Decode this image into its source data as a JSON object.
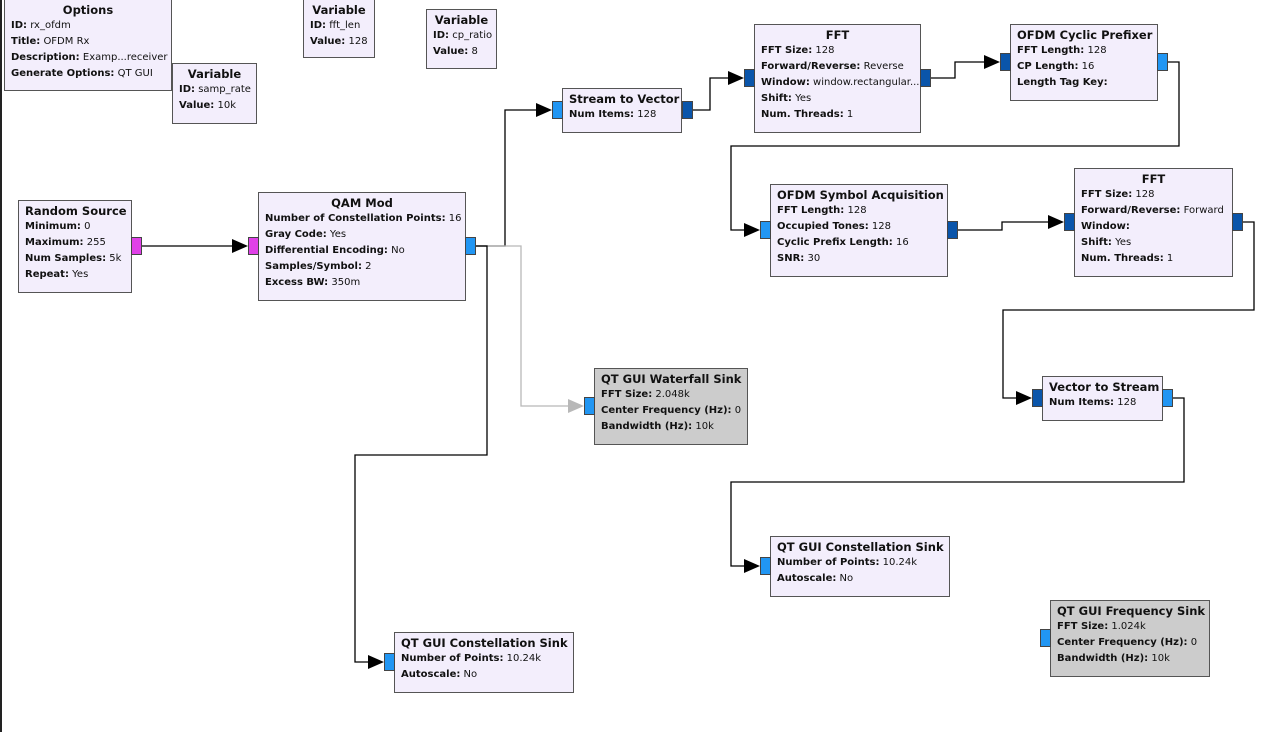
{
  "canvas": {
    "background": "#ffffff"
  },
  "colors": {
    "block_fill": "#f3eefc",
    "block_disabled_fill": "#cccccc",
    "port_byte": "#e040e8",
    "port_complex": "#2196f3",
    "port_complex_vector": "#0a55aa",
    "wire": "#000000",
    "wire_disabled": "#b8b8b8"
  },
  "blocks": {
    "options": {
      "title": "Options",
      "params": [
        {
          "key": "ID:",
          "value": "rx_ofdm"
        },
        {
          "key": "Title:",
          "value": "OFDM Rx"
        },
        {
          "key": "Description:",
          "value": "Examp...receiver"
        },
        {
          "key": "Generate Options:",
          "value": "QT GUI"
        }
      ]
    },
    "var_samp_rate": {
      "title": "Variable",
      "params": [
        {
          "key": "ID:",
          "value": "samp_rate"
        },
        {
          "key": "Value:",
          "value": "10k"
        }
      ]
    },
    "var_fft_len": {
      "title": "Variable",
      "params": [
        {
          "key": "ID:",
          "value": "fft_len"
        },
        {
          "key": "Value:",
          "value": "128"
        }
      ]
    },
    "var_cp_ratio": {
      "title": "Variable",
      "params": [
        {
          "key": "ID:",
          "value": "cp_ratio"
        },
        {
          "key": "Value:",
          "value": "8"
        }
      ]
    },
    "random_source": {
      "title": "Random Source",
      "params": [
        {
          "key": "Minimum:",
          "value": "0"
        },
        {
          "key": "Maximum:",
          "value": "255"
        },
        {
          "key": "Num Samples:",
          "value": "5k"
        },
        {
          "key": "Repeat:",
          "value": "Yes"
        }
      ]
    },
    "qam_mod": {
      "title": "QAM Mod",
      "params": [
        {
          "key": "Number of Constellation Points:",
          "value": "16"
        },
        {
          "key": "Gray Code:",
          "value": "Yes"
        },
        {
          "key": "Differential Encoding:",
          "value": "No"
        },
        {
          "key": "Samples/Symbol:",
          "value": "2"
        },
        {
          "key": "Excess BW:",
          "value": "350m"
        }
      ]
    },
    "stream_to_vector": {
      "title": "Stream to Vector",
      "params": [
        {
          "key": "Num Items:",
          "value": "128"
        }
      ]
    },
    "fft_reverse": {
      "title": "FFT",
      "params": [
        {
          "key": "FFT Size:",
          "value": "128"
        },
        {
          "key": "Forward/Reverse:",
          "value": "Reverse"
        },
        {
          "key": "Window:",
          "value": "window.rectangular..."
        },
        {
          "key": "Shift:",
          "value": "Yes"
        },
        {
          "key": "Num. Threads:",
          "value": "1"
        }
      ]
    },
    "cyclic_prefixer": {
      "title": "OFDM Cyclic Prefixer",
      "params": [
        {
          "key": "FFT Length:",
          "value": "128"
        },
        {
          "key": "CP Length:",
          "value": "16"
        },
        {
          "key": "Length Tag Key:",
          "value": ""
        }
      ]
    },
    "symbol_acquisition": {
      "title": "OFDM Symbol Acquisition",
      "params": [
        {
          "key": "FFT Length:",
          "value": "128"
        },
        {
          "key": "Occupied Tones:",
          "value": "128"
        },
        {
          "key": "Cyclic Prefix Length:",
          "value": "16"
        },
        {
          "key": "SNR:",
          "value": "30"
        }
      ]
    },
    "fft_forward": {
      "title": "FFT",
      "params": [
        {
          "key": "FFT Size:",
          "value": "128"
        },
        {
          "key": "Forward/Reverse:",
          "value": "Forward"
        },
        {
          "key": "Window:",
          "value": ""
        },
        {
          "key": "Shift:",
          "value": "Yes"
        },
        {
          "key": "Num. Threads:",
          "value": "1"
        }
      ]
    },
    "waterfall_sink": {
      "title": "QT GUI Waterfall Sink",
      "disabled": true,
      "params": [
        {
          "key": "FFT Size:",
          "value": "2.048k"
        },
        {
          "key": "Center Frequency (Hz):",
          "value": "0"
        },
        {
          "key": "Bandwidth (Hz):",
          "value": "10k"
        }
      ]
    },
    "vector_to_stream": {
      "title": "Vector to Stream",
      "params": [
        {
          "key": "Num Items:",
          "value": "128"
        }
      ]
    },
    "constellation_sink_rx": {
      "title": "QT GUI Constellation Sink",
      "params": [
        {
          "key": "Number of Points:",
          "value": "10.24k"
        },
        {
          "key": "Autoscale:",
          "value": "No"
        }
      ]
    },
    "frequency_sink": {
      "title": "QT GUI Frequency Sink",
      "disabled": true,
      "params": [
        {
          "key": "FFT Size:",
          "value": "1.024k"
        },
        {
          "key": "Center Frequency (Hz):",
          "value": "0"
        },
        {
          "key": "Bandwidth (Hz):",
          "value": "10k"
        }
      ]
    },
    "constellation_sink_tx": {
      "title": "QT GUI Constellation Sink",
      "params": [
        {
          "key": "Number of Points:",
          "value": "10.24k"
        },
        {
          "key": "Autoscale:",
          "value": "No"
        }
      ]
    }
  },
  "connections": [
    {
      "from": "random_source",
      "to": "qam_mod",
      "enabled": true
    },
    {
      "from": "qam_mod",
      "to": "stream_to_vector",
      "enabled": true
    },
    {
      "from": "qam_mod",
      "to": "waterfall_sink",
      "enabled": false
    },
    {
      "from": "qam_mod",
      "to": "constellation_sink_tx",
      "enabled": true
    },
    {
      "from": "stream_to_vector",
      "to": "fft_reverse",
      "enabled": true
    },
    {
      "from": "fft_reverse",
      "to": "cyclic_prefixer",
      "enabled": true
    },
    {
      "from": "cyclic_prefixer",
      "to": "symbol_acquisition",
      "enabled": true
    },
    {
      "from": "symbol_acquisition",
      "to": "fft_forward",
      "enabled": true
    },
    {
      "from": "fft_forward",
      "to": "vector_to_stream",
      "enabled": true
    },
    {
      "from": "vector_to_stream",
      "to": "constellation_sink_rx",
      "enabled": true
    }
  ]
}
